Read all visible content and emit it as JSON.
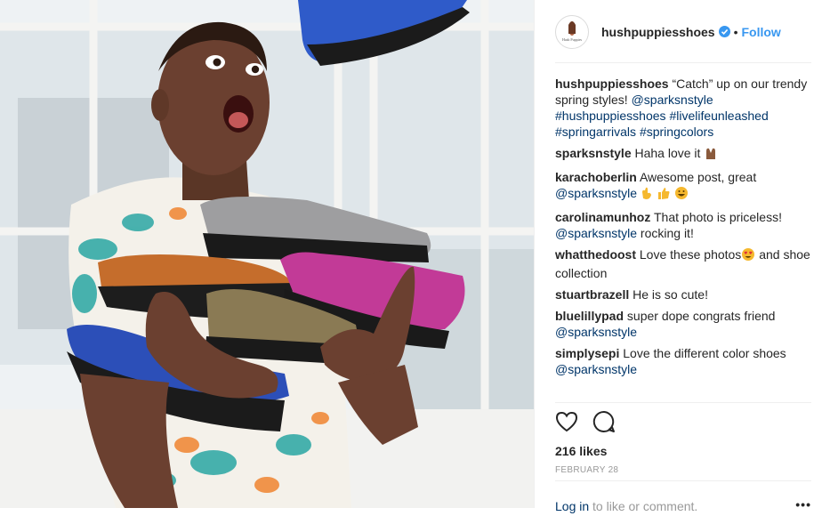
{
  "post": {
    "author": "hushpuppiesshoes",
    "avatar_text": "Hush Puppies",
    "follow_label": "Follow",
    "dot": "•",
    "caption": {
      "user": "hushpuppiesshoes",
      "text": "“Catch” up on our trendy spring styles!",
      "tags": [
        "@sparksnstyle",
        "#hushpuppiesshoes",
        "#livelifeunleashed",
        "#springarrivals",
        "#springcolors"
      ]
    },
    "comments": [
      {
        "user": "sparksnstyle",
        "text": "Haha love it",
        "emoji": [
          "raised-hands"
        ]
      },
      {
        "user": "karachoberlin",
        "text": "Awesome post, great",
        "mention": "@sparksnstyle",
        "emoji": [
          "ok-hand",
          "thumbs-up",
          "grinning-face"
        ]
      },
      {
        "user": "carolinamunhoz",
        "text": "That photo is priceless!",
        "mention": "@sparksnstyle",
        "after": "rocking it!"
      },
      {
        "user": "whatthedoost",
        "text": "Love these photos",
        "emoji": [
          "heart-eyes"
        ],
        "after": "and shoe collection"
      },
      {
        "user": "stuartbrazell",
        "text": "He is so cute!"
      },
      {
        "user": "bluelillypad",
        "text": "super dope congrats friend",
        "mention": "@sparksnstyle"
      },
      {
        "user": "simplysepi",
        "text": "Love the different color shoes",
        "mention": "@sparksnstyle"
      }
    ],
    "likes": "216 likes",
    "date": "FEBRUARY 28",
    "footer": {
      "login": "Log in",
      "rest": "to like or comment.",
      "more": "•••"
    }
  },
  "icons": [
    "verified-badge-icon",
    "heart-icon",
    "comment-icon",
    "more-options-icon"
  ],
  "colors": {
    "link": "#003569",
    "follow": "#3897f0",
    "muted": "#999999",
    "border": "#efefef"
  }
}
